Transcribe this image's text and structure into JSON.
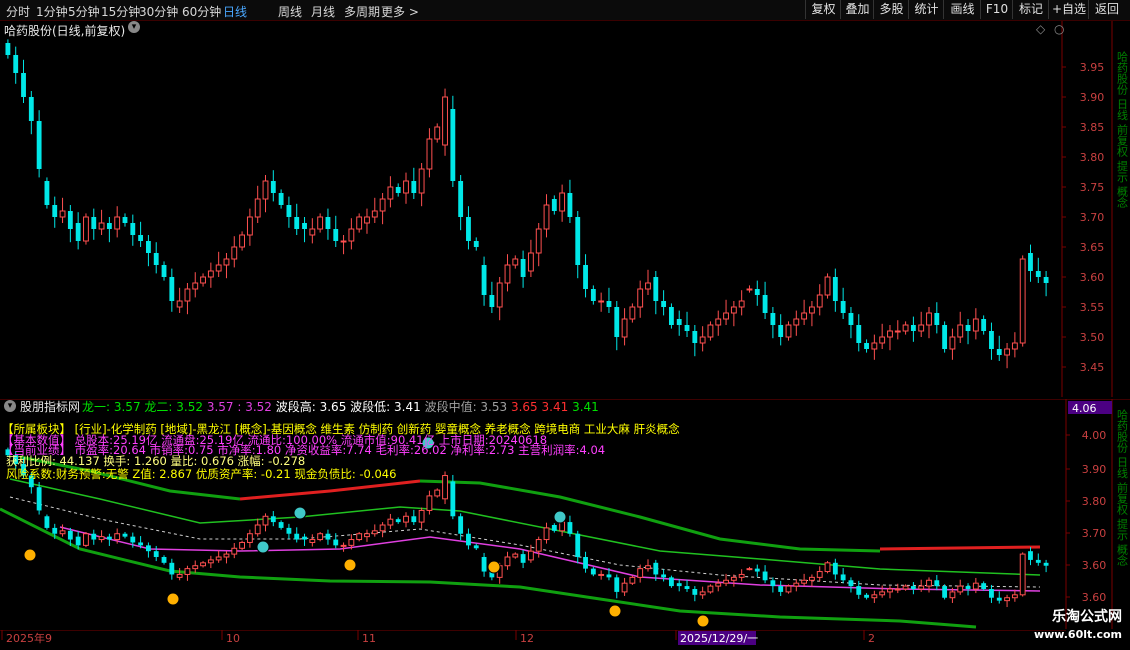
{
  "toolbar": {
    "left": [
      "分时",
      "1分钟",
      "5分钟",
      "15分钟",
      "30分钟",
      "60分钟",
      "日线",
      "周线",
      "月线",
      "多周期",
      "更多 >"
    ],
    "active": "日线",
    "right": [
      "复权",
      "叠加",
      "多股",
      "统计",
      "画线",
      "F10",
      "标记",
      "+自选",
      "返回"
    ]
  },
  "main": {
    "title": "哈药股份(日线,前复权)",
    "price_ticks": [
      "3.95",
      "3.90",
      "3.85",
      "3.80",
      "3.75",
      "3.70",
      "3.65",
      "3.60",
      "3.55",
      "3.50",
      "3.45"
    ],
    "side_text": "哈药股份 日线 前复权 提示 概念"
  },
  "indicator": {
    "name": "股朋指标网",
    "legend": [
      {
        "label": "龙一: 3.57",
        "color": "#00e000"
      },
      {
        "label": "龙二: 3.52",
        "color": "#00e000"
      },
      {
        "label": "3.57 : 3.52",
        "color": "#e040e0"
      },
      {
        "label": "波段高: 3.65",
        "color": "#ffffff"
      },
      {
        "label": "波段低: 3.41",
        "color": "#ffffff"
      },
      {
        "label": "波段中值: 3.53",
        "color": "#a0a0a0"
      },
      {
        "label": "3.65",
        "color": "#ff3030"
      },
      {
        "label": "3.41",
        "color": "#ff3030"
      },
      {
        "label": "3.41",
        "color": "#00e000"
      }
    ],
    "price_box": "4.06",
    "ticks": [
      "4.00",
      "3.90",
      "3.80",
      "3.70",
      "3.60",
      "3.60"
    ],
    "info": {
      "sector_label": "【所属板块】",
      "sector_text": "[行业]-化学制药   [地域]-黑龙江   [概念]-基因概念 维生素 仿制药 创新药 婴童概念 养老概念 跨境电商 工业大麻 肝炎概念",
      "basic_label": "【基本数值】",
      "basic_text": "总股本:25.19亿   流通盘:25.19亿   流通比:100.00%   流通市值:90.41亿   上市日期:20240618",
      "fin_label": "【当前业绩】",
      "fin_text": "市盈率:20.64   市销率:0.75   市净率:1.80   净资收益率:7.74   毛利率:26.02   净利率:2.73   主营利润率:4.04",
      "profit_text": "获利比例: 44.137      换手: 1.260          量比: 0.676          涨幅: -0.278",
      "warn_text": "风险系数:财务预警:无警 Z值: 2.867 优质资产率: -0.21 现金负债比: -0.046"
    }
  },
  "dates": [
    "2025年9",
    "10",
    "11",
    "12",
    "2025/12/29/一",
    "2"
  ],
  "watermark": {
    "name": "乐淘公式网",
    "url": "www.60lt.com"
  },
  "chart_data": {
    "type": "candlestick",
    "title": "哈药股份(日线,前复权)",
    "ylim": [
      3.42,
      3.99
    ],
    "close": [
      3.97,
      3.94,
      3.9,
      3.86,
      3.78,
      3.72,
      3.7,
      3.71,
      3.68,
      3.66,
      3.7,
      3.68,
      3.69,
      3.68,
      3.7,
      3.69,
      3.67,
      3.66,
      3.64,
      3.62,
      3.6,
      3.56,
      3.56,
      3.58,
      3.59,
      3.6,
      3.61,
      3.62,
      3.63,
      3.65,
      3.67,
      3.7,
      3.73,
      3.76,
      3.74,
      3.72,
      3.7,
      3.68,
      3.68,
      3.68,
      3.7,
      3.68,
      3.66,
      3.66,
      3.68,
      3.7,
      3.7,
      3.71,
      3.73,
      3.75,
      3.74,
      3.76,
      3.74,
      3.78,
      3.83,
      3.85,
      3.9,
      3.76,
      3.7,
      3.66,
      3.65,
      3.57,
      3.55,
      3.59,
      3.62,
      3.63,
      3.6,
      3.64,
      3.68,
      3.72,
      3.71,
      3.74,
      3.7,
      3.62,
      3.58,
      3.56,
      3.56,
      3.55,
      3.5,
      3.53,
      3.55,
      3.58,
      3.59,
      3.56,
      3.55,
      3.52,
      3.52,
      3.51,
      3.49,
      3.5,
      3.52,
      3.53,
      3.54,
      3.55,
      3.56,
      3.58,
      3.57,
      3.54,
      3.52,
      3.5,
      3.52,
      3.53,
      3.54,
      3.55,
      3.57,
      3.6,
      3.56,
      3.54,
      3.52,
      3.49,
      3.48,
      3.49,
      3.5,
      3.51,
      3.51,
      3.52,
      3.51,
      3.52,
      3.54,
      3.52,
      3.48,
      3.5,
      3.52,
      3.51,
      3.53,
      3.51,
      3.48,
      3.47,
      3.48,
      3.49,
      3.63,
      3.61,
      3.6,
      3.59
    ],
    "open": [
      3.99,
      3.97,
      3.94,
      3.9,
      3.86,
      3.76,
      3.72,
      3.7,
      3.71,
      3.69,
      3.66,
      3.7,
      3.68,
      3.69,
      3.68,
      3.7,
      3.69,
      3.67,
      3.66,
      3.64,
      3.62,
      3.6,
      3.55,
      3.56,
      3.58,
      3.59,
      3.6,
      3.61,
      3.62,
      3.63,
      3.65,
      3.67,
      3.7,
      3.73,
      3.76,
      3.74,
      3.72,
      3.7,
      3.69,
      3.67,
      3.68,
      3.7,
      3.68,
      3.66,
      3.66,
      3.68,
      3.69,
      3.7,
      3.71,
      3.73,
      3.75,
      3.74,
      3.76,
      3.74,
      3.78,
      3.83,
      3.82,
      3.88,
      3.76,
      3.7,
      3.66,
      3.62,
      3.57,
      3.55,
      3.59,
      3.62,
      3.63,
      3.61,
      3.64,
      3.68,
      3.73,
      3.71,
      3.74,
      3.7,
      3.62,
      3.58,
      3.56,
      3.56,
      3.55,
      3.5,
      3.53,
      3.55,
      3.58,
      3.6,
      3.56,
      3.55,
      3.53,
      3.52,
      3.51,
      3.49,
      3.5,
      3.52,
      3.53,
      3.54,
      3.55,
      3.58,
      3.58,
      3.57,
      3.54,
      3.52,
      3.5,
      3.52,
      3.53,
      3.54,
      3.55,
      3.57,
      3.6,
      3.56,
      3.54,
      3.52,
      3.49,
      3.48,
      3.49,
      3.5,
      3.51,
      3.51,
      3.52,
      3.51,
      3.52,
      3.54,
      3.52,
      3.48,
      3.5,
      3.52,
      3.51,
      3.53,
      3.51,
      3.48,
      3.47,
      3.48,
      3.49,
      3.64,
      3.61,
      3.6
    ]
  }
}
